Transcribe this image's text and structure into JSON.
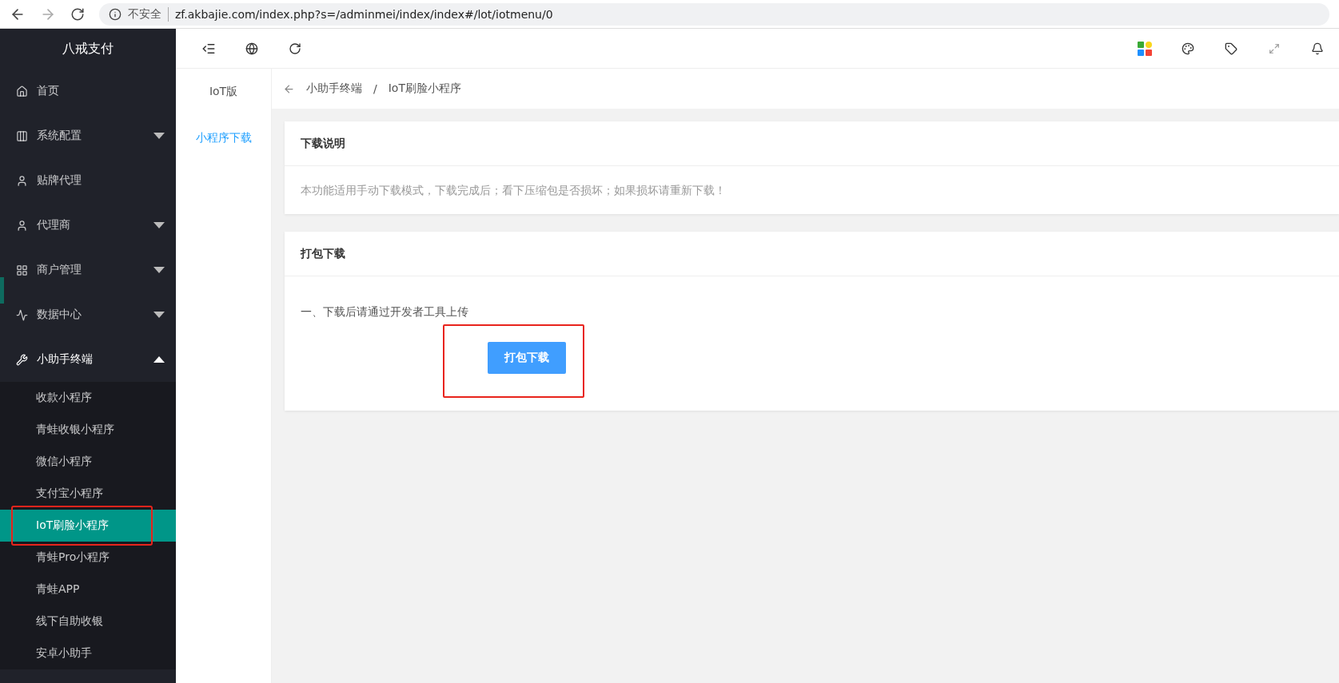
{
  "browser": {
    "security_label": "不安全",
    "url": "zf.akbajie.com/index.php?s=/adminmei/index/index#/lot/iotmenu/0"
  },
  "sidebar": {
    "title": "八戒支付",
    "items": [
      {
        "label": "首页"
      },
      {
        "label": "系统配置",
        "expanded": false
      },
      {
        "label": "贴牌代理"
      },
      {
        "label": "代理商",
        "expanded": false
      },
      {
        "label": "商户管理",
        "expanded": false
      },
      {
        "label": "数据中心",
        "expanded": false
      },
      {
        "label": "小助手终端",
        "expanded": true,
        "children": [
          {
            "label": "收款小程序",
            "selected": false,
            "highlighted": false
          },
          {
            "label": "青蛙收银小程序",
            "selected": false,
            "highlighted": false
          },
          {
            "label": "微信小程序",
            "selected": false,
            "highlighted": false
          },
          {
            "label": "支付宝小程序",
            "selected": false,
            "highlighted": false
          },
          {
            "label": "IoT刷脸小程序",
            "selected": true,
            "highlighted": true
          },
          {
            "label": "青蛙Pro小程序",
            "selected": false,
            "highlighted": false
          },
          {
            "label": "青蛙APP",
            "selected": false,
            "highlighted": false
          },
          {
            "label": "线下自助收银",
            "selected": false,
            "highlighted": false
          },
          {
            "label": "安卓小助手",
            "selected": false,
            "highlighted": false
          }
        ]
      }
    ]
  },
  "subnav": {
    "items": [
      {
        "label": "IoT版",
        "selected": false
      },
      {
        "label": "小程序下载",
        "selected": true
      }
    ]
  },
  "breadcrumb": [
    "小助手终端",
    "IoT刷脸小程序"
  ],
  "breadcrumb_separator": "/",
  "cards": [
    {
      "title": "下载说明",
      "kind": "note",
      "text": "本功能适用手动下载模式，下载完成后；看下压缩包是否损坏；如果损坏请重新下载！"
    },
    {
      "title": "打包下载",
      "kind": "download",
      "text": "一、下载后请通过开发者工具上传",
      "button": {
        "label": "打包下载",
        "highlighted": true
      }
    }
  ]
}
